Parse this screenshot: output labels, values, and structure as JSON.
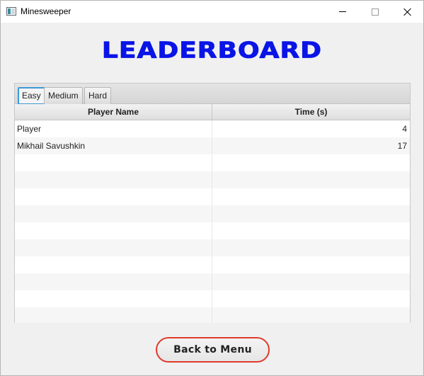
{
  "window": {
    "title": "Minesweeper",
    "controls": [
      "minimize",
      "maximize",
      "close"
    ]
  },
  "heading": "LEADERBOARD",
  "colors": {
    "heading": "#0a14e6",
    "button_border": "#e03a2a",
    "active_tab_outline": "#3c9ad6"
  },
  "tabs": [
    {
      "label": "Easy",
      "active": true
    },
    {
      "label": "Medium",
      "active": false
    },
    {
      "label": "Hard",
      "active": false
    }
  ],
  "table": {
    "columns": [
      "Player Name",
      "Time (s)"
    ],
    "rows": [
      {
        "player": "Player",
        "time": "4"
      },
      {
        "player": "Mikhail Savushkin",
        "time": "17"
      }
    ],
    "empty_row_count": 10
  },
  "back_button_label": "Back to Menu"
}
